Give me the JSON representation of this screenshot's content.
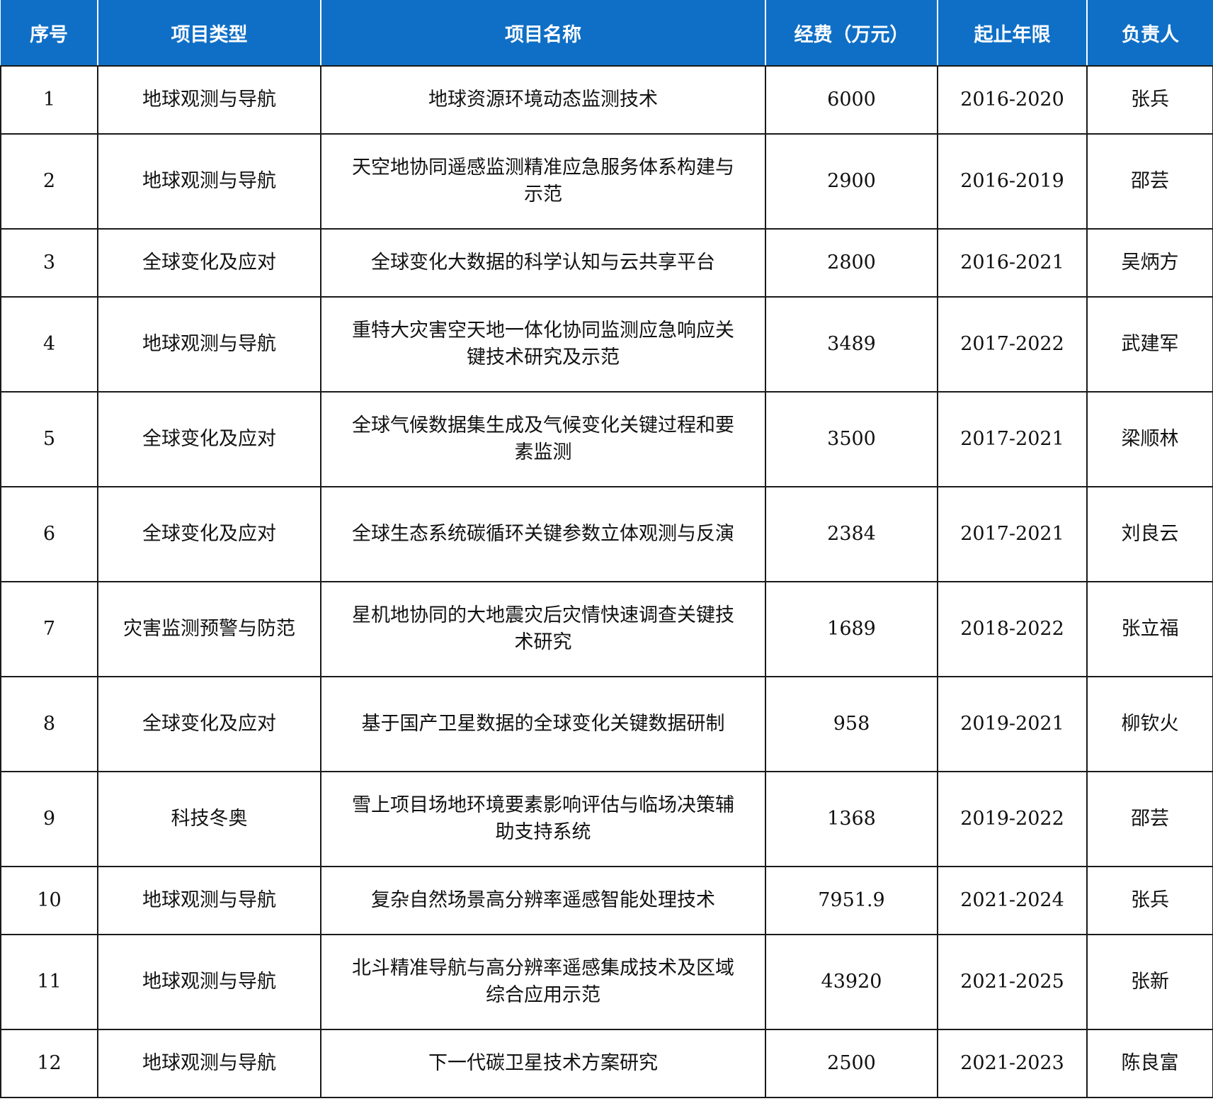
{
  "table": {
    "headers": [
      "序号",
      "项目类型",
      "项目名称",
      "经费（万元）",
      "起止年限",
      "负责人"
    ],
    "rows": [
      {
        "no": "1",
        "type": "地球观测与导航",
        "name": "地球资源环境动态监测技术",
        "funding": "6000",
        "period": "2016-2020",
        "leader": "张兵"
      },
      {
        "no": "2",
        "type": "地球观测与导航",
        "name": "天空地协同遥感监测精准应急服务体系构建与示范",
        "funding": "2900",
        "period": "2016-2019",
        "leader": "邵芸"
      },
      {
        "no": "3",
        "type": "全球变化及应对",
        "name": "全球变化大数据的科学认知与云共享平台",
        "funding": "2800",
        "period": "2016-2021",
        "leader": "吴炳方"
      },
      {
        "no": "4",
        "type": "地球观测与导航",
        "name": "重特大灾害空天地一体化协同监测应急响应关键技术研究及示范",
        "funding": "3489",
        "period": "2017-2022",
        "leader": "武建军"
      },
      {
        "no": "5",
        "type": "全球变化及应对",
        "name": "全球气候数据集生成及气候变化关键过程和要素监测",
        "funding": "3500",
        "period": "2017-2021",
        "leader": "梁顺林"
      },
      {
        "no": "6",
        "type": "全球变化及应对",
        "name": "全球生态系统碳循环关键参数立体观测与反演",
        "funding": "2384",
        "period": "2017-2021",
        "leader": "刘良云"
      },
      {
        "no": "7",
        "type": "灾害监测预警与防范",
        "name": "星机地协同的大地震灾后灾情快速调查关键技术研究",
        "funding": "1689",
        "period": "2018-2022",
        "leader": "张立福"
      },
      {
        "no": "8",
        "type": "全球变化及应对",
        "name": "基于国产卫星数据的全球变化关键数据研制",
        "funding": "958",
        "period": "2019-2021",
        "leader": "柳钦火"
      },
      {
        "no": "9",
        "type": "科技冬奥",
        "name": "雪上项目场地环境要素影响评估与临场决策辅助支持系统",
        "funding": "1368",
        "period": "2019-2022",
        "leader": "邵芸"
      },
      {
        "no": "10",
        "type": "地球观测与导航",
        "name": "复杂自然场景高分辨率遥感智能处理技术",
        "funding": "7951.9",
        "period": "2021-2024",
        "leader": "张兵"
      },
      {
        "no": "11",
        "type": "地球观测与导航",
        "name": "北斗精准导航与高分辨率遥感集成技术及区域综合应用示范",
        "funding": "43920",
        "period": "2021-2025",
        "leader": "张新"
      },
      {
        "no": "12",
        "type": "地球观测与导航",
        "name": "下一代碳卫星技术方案研究",
        "funding": "2500",
        "period": "2021-2023",
        "leader": "陈良富"
      }
    ]
  },
  "colors": {
    "header_bg": "#0f6fc6",
    "header_text": "#ffffff",
    "border": "#1a1a1a"
  }
}
